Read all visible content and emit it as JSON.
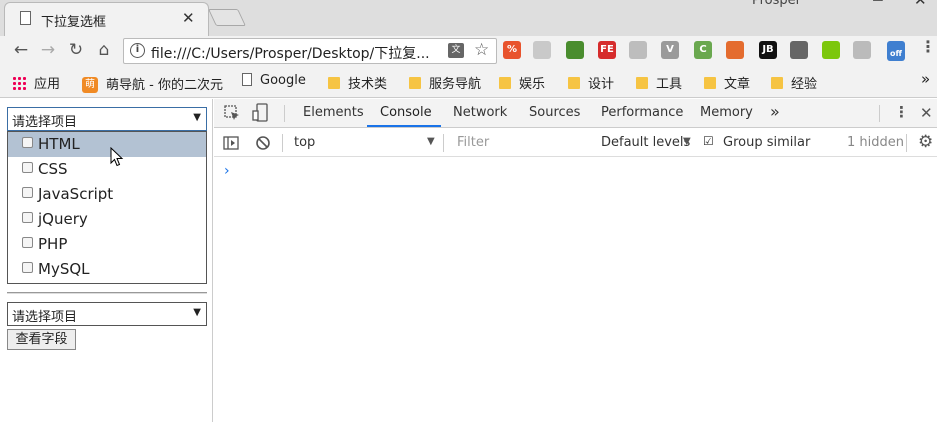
{
  "browser": {
    "tab_title": "下拉复选框",
    "tab_close": "✕",
    "window_user": "Prosper",
    "url": "file:///C:/Users/Prosper/Desktop/下拉复...",
    "translate_icon": "文",
    "extensions": [
      {
        "icon": "discount-icon",
        "label": "%",
        "color": "#e8532d"
      },
      {
        "icon": "magnifier-icon",
        "label": "",
        "color": "#c9c9c9"
      },
      {
        "icon": "bookmark-green-icon",
        "label": "",
        "color": "#4a8d2e"
      },
      {
        "icon": "fe-icon",
        "label": "FE",
        "color": "#d62c2c"
      },
      {
        "icon": "screenshot-icon",
        "label": "",
        "color": "#bdbdbd"
      },
      {
        "icon": "vue-icon",
        "label": "V",
        "color": "#9a9a9a"
      },
      {
        "icon": "c-icon",
        "label": "C",
        "color": "#6aa84f"
      },
      {
        "icon": "office-icon",
        "label": "",
        "color": "#e46c2f"
      },
      {
        "icon": "jetbrains-icon",
        "label": "JB",
        "color": "#111111"
      },
      {
        "icon": "camera-icon",
        "label": "",
        "color": "#666666"
      },
      {
        "icon": "refresh-green-icon",
        "label": "",
        "color": "#7cc70c"
      },
      {
        "icon": "share-icon",
        "label": "",
        "color": "#bbbbbb"
      },
      {
        "icon": "proxy-off-icon",
        "label": "off",
        "color": "#3f7fd0"
      }
    ]
  },
  "bookmarks": {
    "apps": "应用",
    "items": [
      "萌导航 - 你的二次元",
      "Google",
      "技术类",
      "服务导航",
      "娱乐",
      "设计",
      "工具",
      "文章",
      "经验"
    ],
    "more": "»"
  },
  "page": {
    "select1_text": "请选择项目",
    "options": [
      "HTML",
      "CSS",
      "JavaScript",
      "jQuery",
      "PHP",
      "MySQL"
    ],
    "select2_text": "请选择项目",
    "button_label": "查看字段"
  },
  "devtools": {
    "tabs": [
      "Elements",
      "Console",
      "Network",
      "Sources",
      "Performance",
      "Memory"
    ],
    "more_tabs": "»",
    "active_tab": "Console",
    "context": "top",
    "filter_placeholder": "Filter",
    "levels": "Default levels",
    "group_similar": "Group similar",
    "hidden_count": "1 hidden",
    "prompt": "›"
  }
}
